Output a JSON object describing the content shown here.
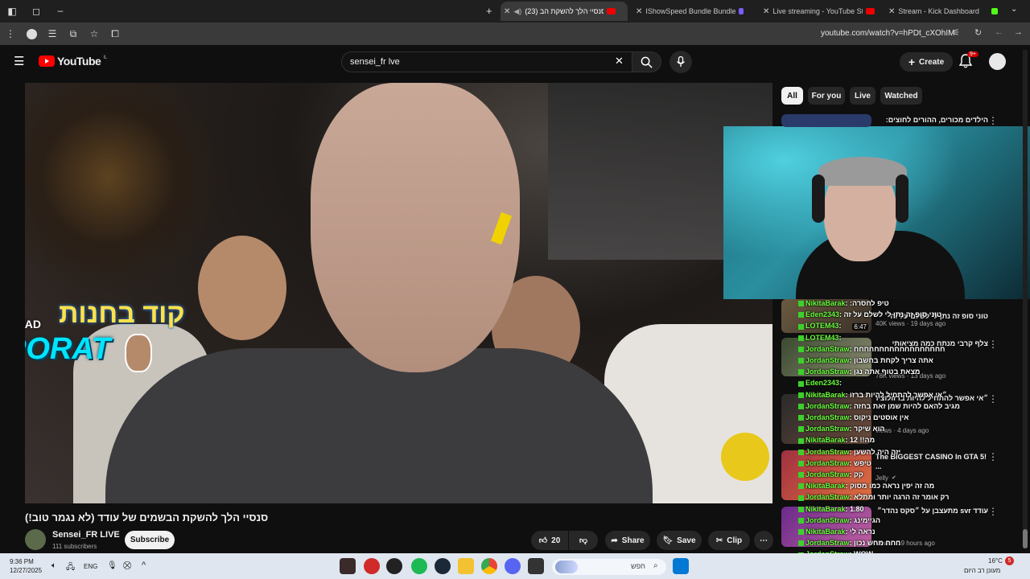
{
  "browser": {
    "tabs": [
      {
        "label": "(23) סנסיי הלך להשקת הב",
        "active": true
      },
      {
        "label": "IShowSpeed Bundle Bundle - Fr",
        "active": false
      },
      {
        "label": "Live streaming - YouTube Studio",
        "active": false
      },
      {
        "label": "Stream - Kick Dashboard",
        "active": false
      }
    ],
    "url": "youtube.com/watch?v=hPDt_cXOhIM"
  },
  "youtube": {
    "logo": "YouTube",
    "region": "IL",
    "search_value": "sensei_fr lve",
    "create_label": "Create",
    "notifications_badge": "9+"
  },
  "video": {
    "overlay_text_1": "קוד בחנות",
    "overlay_text_2": "PORAT",
    "overlay_ad": "#AD",
    "title": "סנסיי הלך להשקת הבשמים של עודד (לא נגמר טוב!)",
    "channel_name": "Sensei_FR LIVE",
    "subscribers": "111 subscribers",
    "subscribe_label": "Subscribe",
    "likes": "20",
    "share_label": "Share",
    "save_label": "Save",
    "clip_label": "Clip"
  },
  "sidebar": {
    "chips": [
      "All",
      "For you",
      "Live",
      "Watched"
    ],
    "items": [
      {
        "title": "הילדים מכורים, ההורים לחוצים:",
        "meta": ""
      },
      {
        "title": "טוני סופ זה נתן לי לשלם על זה",
        "meta": "40K views · 19 days ago",
        "duration": "6:47"
      },
      {
        "title": "צלף קרבי מנתח כמה מציאותי",
        "meta": "78K views · 13 days ago"
      },
      {
        "title": "״אי אפשר להתחיל להיות ברזולוציה הבאה״",
        "meta": "views · 4 days ago"
      },
      {
        "title": "The BIGGEST CASINO In GTA 5! ...",
        "meta": "Jelly"
      },
      {
        "title": "עודד svr מתעצבן על ״סקס נהדר״",
        "meta": "views · 19 hours ago"
      }
    ]
  },
  "chat": [
    {
      "user": "NikitaBarak",
      "msg": ":טיפ לחסרה"
    },
    {
      "user": "Eden2343",
      "msg": "טוני סופ זה נתן לי לשלם על זה"
    },
    {
      "user": "LOTEM43",
      "msg": ""
    },
    {
      "user": "LOTEM43",
      "msg": ""
    },
    {
      "user": "JordanStraw",
      "msg": "חחחחחחחחחחחחחחחחחח"
    },
    {
      "user": "JordanStraw",
      "msg": "אתה צריך לקחת בחשבון"
    },
    {
      "user": "JordanStraw",
      "msg": "מצאת בטוף אתה נגן"
    },
    {
      "user": "Eden2343",
      "msg": ""
    },
    {
      "user": "NikitaBarak",
      "msg": "״אי אפשר להתחיל להיות ברזו"
    },
    {
      "user": "JordanStraw",
      "msg": "מגיב להאם להיות שמן זאת בחזה"
    },
    {
      "user": "JordanStraw",
      "msg": "אין אוסטים ניקוס"
    },
    {
      "user": "JordanStraw",
      "msg": "הוא שיקר"
    },
    {
      "user": "NikitaBarak",
      "msg": "12 !!מה"
    },
    {
      "user": "JordanStraw",
      "msg": "יזה היה להשען"
    },
    {
      "user": "JordanStraw",
      "msg": "טיפש"
    },
    {
      "user": "JordanStraw",
      "msg": "קק"
    },
    {
      "user": "NikitaBarak",
      "msg": "מה זה יפין נראה כמו מסוק"
    },
    {
      "user": "JordanStraw",
      "msg": "רק אומר זה הרגה יותר ומתלא"
    },
    {
      "user": "NikitaBarak",
      "msg": "1.80"
    },
    {
      "user": "JordanStraw",
      "msg": "הגיימינג"
    },
    {
      "user": "NikitaBarak",
      "msg": "נראה לי"
    },
    {
      "user": "JordanStraw",
      "msg": "חחח מחש נכון"
    },
    {
      "user": "JordanStraw",
      "msg": "WOW"
    },
    {
      "user": "JordanStraw",
      "msg": "HOW"
    }
  ],
  "taskbar": {
    "time": "9:36 PM",
    "date": "12/27/2025",
    "lang": "ENG",
    "search_placeholder": "חפש",
    "weather_temp": "16°C",
    "weather_desc": "מעונן רב היום",
    "notif_count": "5"
  }
}
